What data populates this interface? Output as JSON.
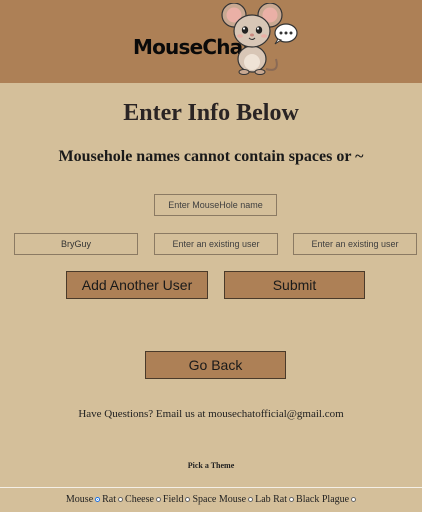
{
  "header": {
    "brand": "MouseChat",
    "mascot_icon": "mouse-mascot-icon"
  },
  "main": {
    "title": "Enter Info Below",
    "subtitle": "Mousehole names cannot contain spaces or ~",
    "mousehole_name": {
      "value": "",
      "placeholder": "Enter MouseHole name"
    },
    "users": [
      {
        "value": "BryGuy",
        "placeholder": ""
      },
      {
        "value": "",
        "placeholder": "Enter an existing user"
      },
      {
        "value": "",
        "placeholder": "Enter an existing user"
      }
    ],
    "add_user_label": "Add Another User",
    "submit_label": "Submit",
    "go_back_label": "Go Back"
  },
  "footer": {
    "contact": "Have Questions? Email us at mousechatofficial@gmail.com",
    "theme_label": "Pick a Theme",
    "themes": [
      {
        "label": "Mouse",
        "selected": true
      },
      {
        "label": "Rat",
        "selected": false
      },
      {
        "label": "Cheese",
        "selected": false
      },
      {
        "label": "Field",
        "selected": false
      },
      {
        "label": "Space Mouse",
        "selected": false
      },
      {
        "label": "Lab Rat",
        "selected": false
      },
      {
        "label": "Black Plague",
        "selected": false
      }
    ]
  },
  "colors": {
    "header_bg": "#ad8056",
    "page_bg": "#d4bf9a",
    "button_bg": "#ad8056"
  }
}
